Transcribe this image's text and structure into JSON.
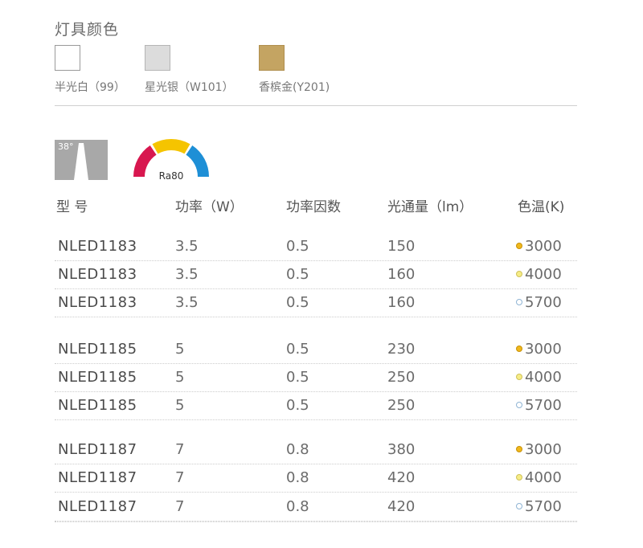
{
  "section_title": "灯具颜色",
  "swatches": [
    {
      "label": "半光白（99）",
      "color": "#ffffff",
      "border": "#9a9a9a"
    },
    {
      "label": "星光银（W101）",
      "color": "#dcdcdc",
      "border": "#b5b5b5"
    },
    {
      "label": "香槟金(Y201)",
      "color": "#c4a462",
      "border": "#b08f4e"
    }
  ],
  "beam_angle": "38°",
  "ra_label": "Ra80",
  "ra_colors": [
    "#d8174f",
    "#f5c400",
    "#1e8fd6"
  ],
  "headers": {
    "model": "型 号",
    "power": "功率（W）",
    "pf": "功率因数",
    "lumen": "光通量（lm）",
    "cct": "色温(K)"
  },
  "cct_colors": {
    "3000": {
      "fill": "#f0b81c",
      "border": "#c8920a"
    },
    "4000": {
      "fill": "#f6ec86",
      "border": "#cfc25a"
    },
    "5700": {
      "fill": "#ffffff",
      "border": "#8fb4d4"
    }
  },
  "rows": [
    {
      "model": "NLED1183",
      "power": "3.5",
      "pf": "0.5",
      "lumen": "150",
      "cct": "3000"
    },
    {
      "model": "NLED1183",
      "power": "3.5",
      "pf": "0.5",
      "lumen": "160",
      "cct": "4000"
    },
    {
      "model": "NLED1183",
      "power": "3.5",
      "pf": "0.5",
      "lumen": "160",
      "cct": "5700"
    },
    {
      "model": "NLED1185",
      "power": "5",
      "pf": "0.5",
      "lumen": "230",
      "cct": "3000"
    },
    {
      "model": "NLED1185",
      "power": "5",
      "pf": "0.5",
      "lumen": "250",
      "cct": "4000"
    },
    {
      "model": "NLED1185",
      "power": "5",
      "pf": "0.5",
      "lumen": "250",
      "cct": "5700"
    },
    {
      "model": "NLED1187",
      "power": "7",
      "pf": "0.8",
      "lumen": "380",
      "cct": "3000"
    },
    {
      "model": "NLED1187",
      "power": "7",
      "pf": "0.8",
      "lumen": "420",
      "cct": "4000"
    },
    {
      "model": "NLED1187",
      "power": "7",
      "pf": "0.8",
      "lumen": "420",
      "cct": "5700"
    }
  ]
}
